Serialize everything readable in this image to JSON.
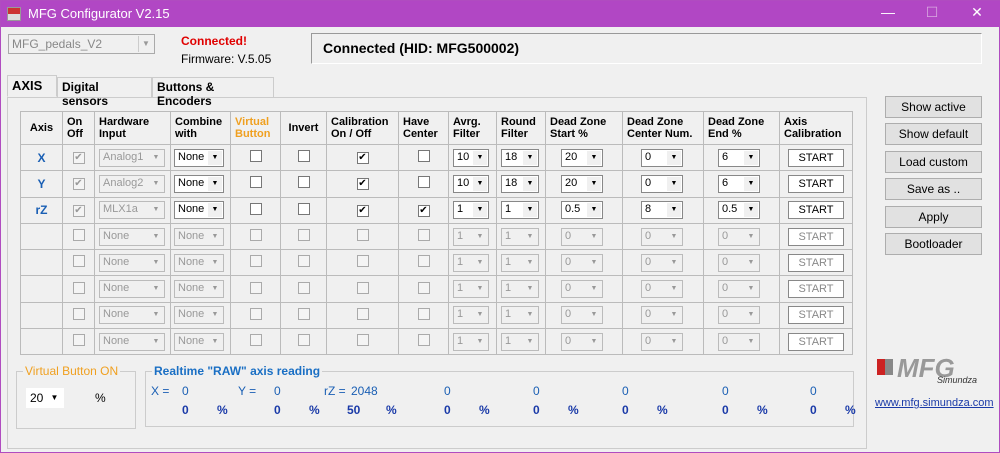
{
  "window": {
    "title": "MFG Configurator V2.15",
    "minimize": "—",
    "maximize": "☐",
    "close": "✕"
  },
  "profile": {
    "value": "MFG_pedals_V2"
  },
  "status": {
    "connected": "Connected!",
    "firmware": "Firmware: V.5.05",
    "box": "Connected (HID: MFG500002)"
  },
  "tabs": [
    "AXIS",
    "Digital sensors",
    "Buttons & Encoders"
  ],
  "headers": [
    "Axis",
    [
      "On",
      "Off"
    ],
    [
      "Hardware",
      "Input"
    ],
    [
      "Combine",
      "with"
    ],
    [
      "Virtual",
      "Button"
    ],
    "Invert",
    [
      "Calibration",
      "On / Off"
    ],
    [
      "Have",
      "Center"
    ],
    [
      "Avrg.",
      "Filter"
    ],
    [
      "Round",
      "Filter"
    ],
    [
      "Dead Zone",
      "Start %"
    ],
    [
      "Dead Zone",
      "Center Num."
    ],
    [
      "Dead Zone",
      "End  %"
    ],
    [
      "Axis",
      "Calibration"
    ]
  ],
  "rows": [
    {
      "axis": "X",
      "on": true,
      "hw": "Analog1",
      "combine": "None",
      "vb": false,
      "inv": false,
      "cal": true,
      "center": false,
      "avrg": "10",
      "round": "18",
      "dzs": "20",
      "dzc": "0",
      "dze": "6",
      "enabled": true
    },
    {
      "axis": "Y",
      "on": true,
      "hw": "Analog2",
      "combine": "None",
      "vb": false,
      "inv": false,
      "cal": true,
      "center": false,
      "avrg": "10",
      "round": "18",
      "dzs": "20",
      "dzc": "0",
      "dze": "6",
      "enabled": true
    },
    {
      "axis": "rZ",
      "on": true,
      "hw": "MLX1a",
      "combine": "None",
      "vb": false,
      "inv": false,
      "cal": true,
      "center": true,
      "avrg": "1",
      "round": "1",
      "dzs": "0.5",
      "dzc": "8",
      "dze": "0.5",
      "enabled": true
    },
    {
      "axis": "",
      "on": false,
      "hw": "None",
      "combine": "None",
      "vb": false,
      "inv": false,
      "cal": false,
      "center": false,
      "avrg": "1",
      "round": "1",
      "dzs": "0",
      "dzc": "0",
      "dze": "0",
      "enabled": false
    },
    {
      "axis": "",
      "on": false,
      "hw": "None",
      "combine": "None",
      "vb": false,
      "inv": false,
      "cal": false,
      "center": false,
      "avrg": "1",
      "round": "1",
      "dzs": "0",
      "dzc": "0",
      "dze": "0",
      "enabled": false
    },
    {
      "axis": "",
      "on": false,
      "hw": "None",
      "combine": "None",
      "vb": false,
      "inv": false,
      "cal": false,
      "center": false,
      "avrg": "1",
      "round": "1",
      "dzs": "0",
      "dzc": "0",
      "dze": "0",
      "enabled": false
    },
    {
      "axis": "",
      "on": false,
      "hw": "None",
      "combine": "None",
      "vb": false,
      "inv": false,
      "cal": false,
      "center": false,
      "avrg": "1",
      "round": "1",
      "dzs": "0",
      "dzc": "0",
      "dze": "0",
      "enabled": false
    },
    {
      "axis": "",
      "on": false,
      "hw": "None",
      "combine": "None",
      "vb": false,
      "inv": false,
      "cal": false,
      "center": false,
      "avrg": "1",
      "round": "1",
      "dzs": "0",
      "dzc": "0",
      "dze": "0",
      "enabled": false
    }
  ],
  "start_label": "START",
  "side_buttons": [
    "Show active",
    "Show default",
    "Load custom",
    "Save as ..",
    "Apply",
    "Bootloader"
  ],
  "virtual_button": {
    "title": "Virtual Button ON",
    "value": "20",
    "unit": "%"
  },
  "realtime": {
    "title": "Realtime \"RAW\" axis reading",
    "raw": [
      {
        "label": "X =",
        "value": "0"
      },
      {
        "label": "Y =",
        "value": "0"
      },
      {
        "label": "rZ =",
        "value": "2048"
      },
      {
        "label": "",
        "value": "0"
      },
      {
        "label": "",
        "value": "0"
      },
      {
        "label": "",
        "value": "0"
      },
      {
        "label": "",
        "value": "0"
      },
      {
        "label": "",
        "value": "0"
      }
    ],
    "percent": [
      "0",
      "0",
      "50",
      "0",
      "0",
      "0",
      "0",
      "0"
    ],
    "unit": "%"
  },
  "logo": {
    "text": "MFG",
    "sub": "Simundza"
  },
  "link": "www.mfg.simundza.com",
  "colors": {
    "title_bar": "#b147c4",
    "connected": "#e00000",
    "orange": "#f0a020",
    "blue": "#1a3aa8"
  }
}
